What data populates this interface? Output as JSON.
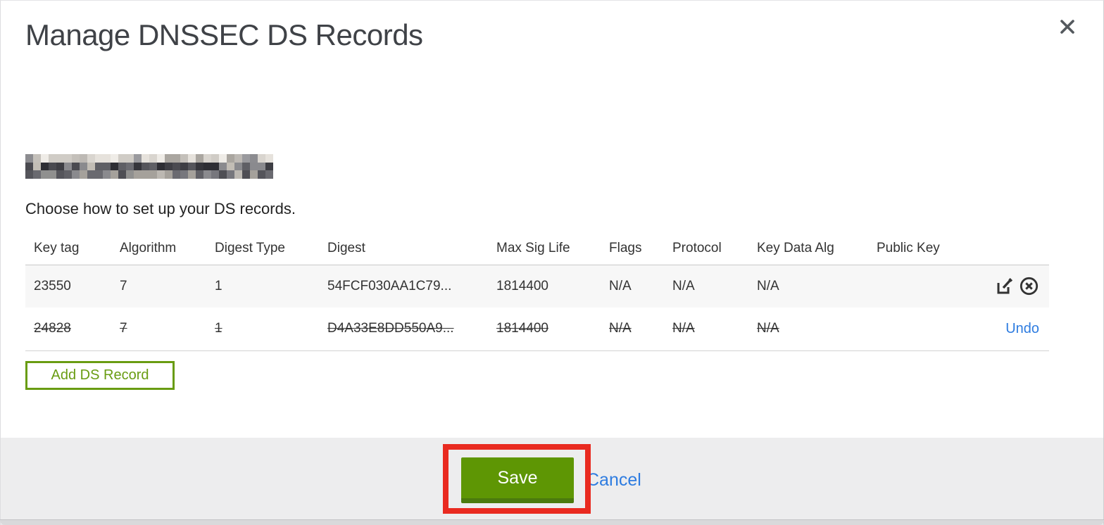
{
  "modal": {
    "title": "Manage DNSSEC DS Records",
    "instruction": "Choose how to set up your DS records.",
    "domain_redacted": true
  },
  "table": {
    "columns": [
      "Key tag",
      "Algorithm",
      "Digest Type",
      "Digest",
      "Max Sig Life",
      "Flags",
      "Protocol",
      "Key Data Alg",
      "Public Key"
    ],
    "rows": [
      {
        "key_tag": "23550",
        "algorithm": "7",
        "digest_type": "1",
        "digest": "54FCF030AA1C79...",
        "max_sig_life": "1814400",
        "flags": "N/A",
        "protocol": "N/A",
        "key_data_alg": "N/A",
        "public_key": "",
        "state": "current",
        "actions": [
          "edit",
          "remove"
        ]
      },
      {
        "key_tag": "24828",
        "algorithm": "7",
        "digest_type": "1",
        "digest": "D4A33E8DD550A9...",
        "max_sig_life": "1814400",
        "flags": "N/A",
        "protocol": "N/A",
        "key_data_alg": "N/A",
        "public_key": "",
        "state": "deleted",
        "undo_label": "Undo"
      }
    ]
  },
  "buttons": {
    "add_ds_record": "Add DS Record",
    "save": "Save",
    "cancel": "Cancel"
  },
  "icons": {
    "close": "close-icon",
    "edit": "edit-icon",
    "remove": "remove-circle-icon"
  },
  "colors": {
    "save_button_green": "#5e9604",
    "save_button_edge": "#4b7a0e",
    "add_button_green": "#699c12",
    "link_blue": "#2e7ce0",
    "annotation_red": "#e92a20",
    "row_highlight": "#f7f7f7",
    "footer_gray": "#ededee"
  }
}
